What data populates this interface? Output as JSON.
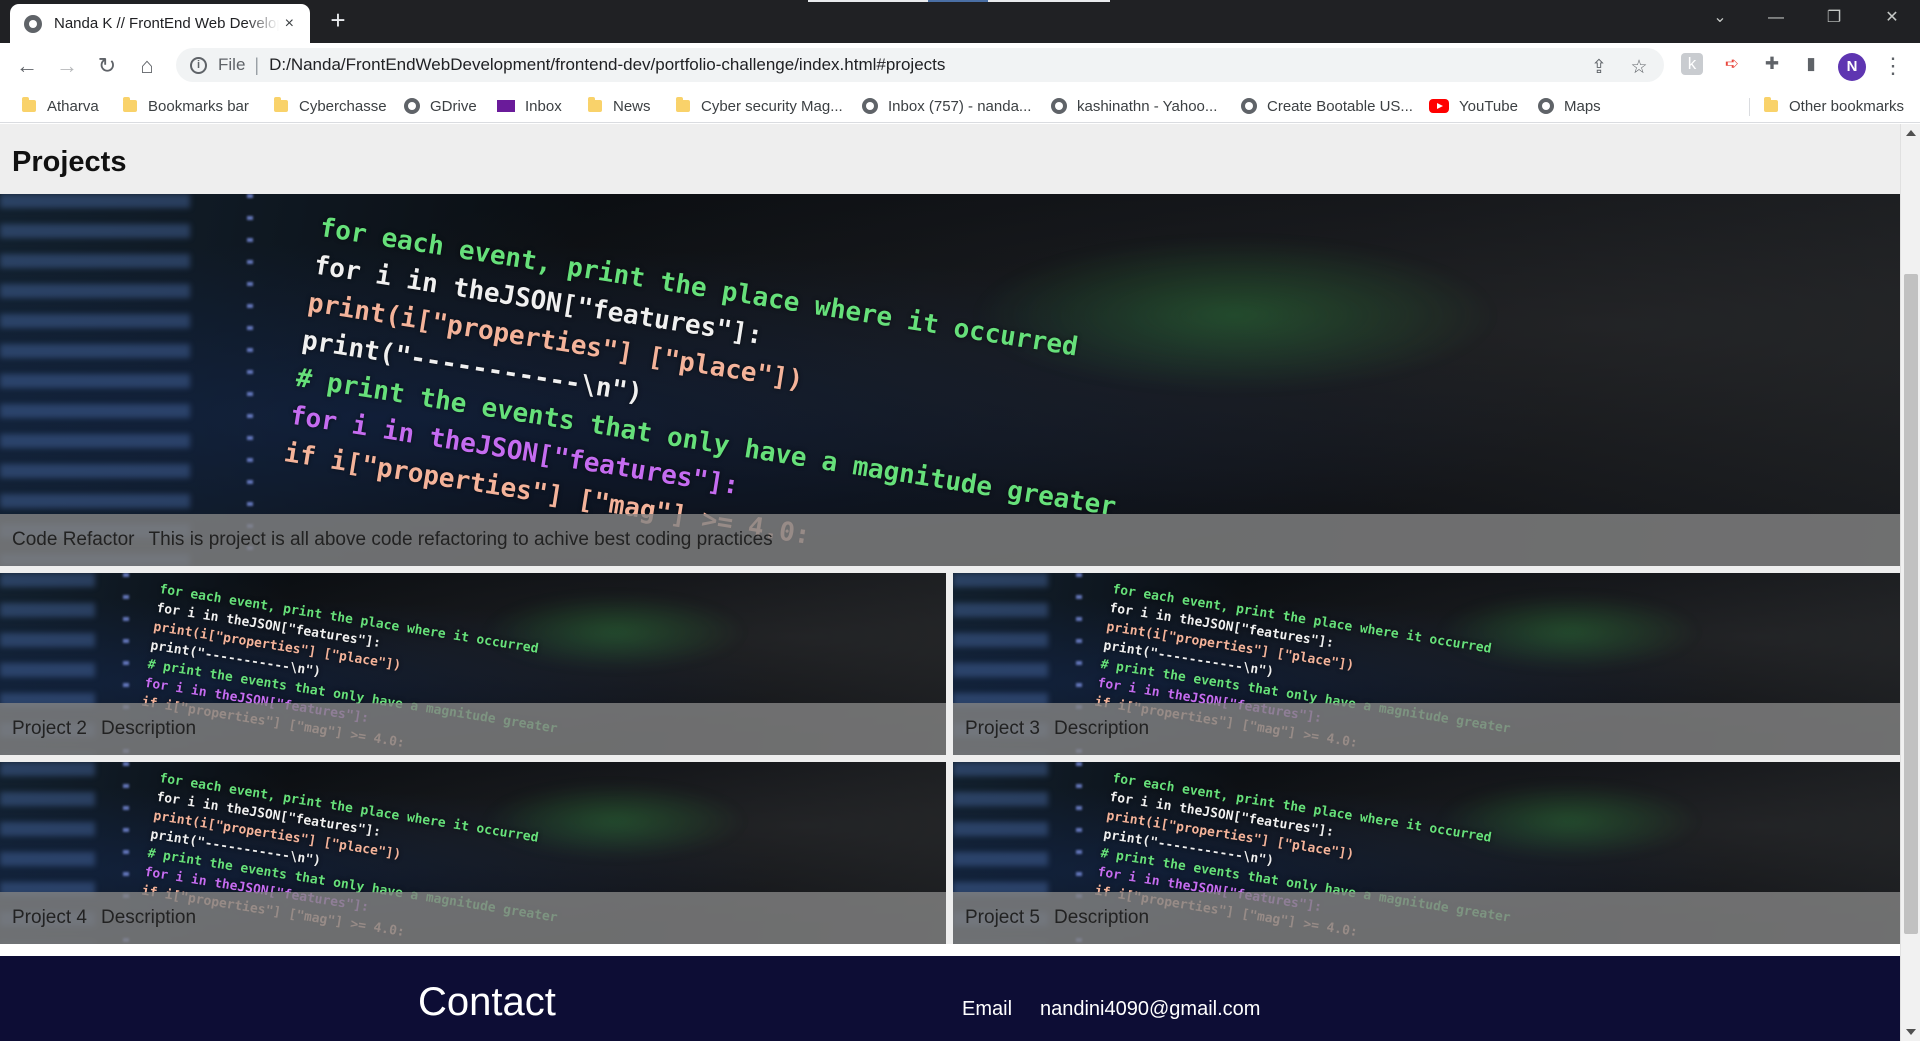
{
  "browser": {
    "tab_title": "Nanda K // FrontEnd Web Developer",
    "tab_close": "×",
    "new_tab": "+",
    "url_scheme": "File",
    "url_separator": "|",
    "url": "D:/Nanda/FrontEndWebDevelopment/frontend-dev/portfolio-challenge/index.html#projects",
    "profile_initial": "N",
    "window_controls": [
      "⌄",
      "—",
      "❐",
      "✕"
    ]
  },
  "bookmarks": [
    {
      "label": "Atharva",
      "icon": "folder-icon"
    },
    {
      "label": "Bookmarks bar",
      "icon": "folder-icon"
    },
    {
      "label": "Cyberchasse",
      "icon": "folder-icon"
    },
    {
      "label": "GDrive",
      "icon": "globe-icon"
    },
    {
      "label": "Inbox",
      "icon": "mail-icon"
    },
    {
      "label": "News",
      "icon": "folder-icon"
    },
    {
      "label": "Cyber security Mag...",
      "icon": "folder-icon"
    },
    {
      "label": "Inbox (757) - nanda...",
      "icon": "globe-icon"
    },
    {
      "label": "kashinathn - Yahoo...",
      "icon": "globe-icon"
    },
    {
      "label": "Create Bootable US...",
      "icon": "globe-icon"
    },
    {
      "label": "YouTube",
      "icon": "youtube-icon"
    },
    {
      "label": "Maps",
      "icon": "globe-icon"
    },
    {
      "label": "Other bookmarks",
      "icon": "folder-icon"
    }
  ],
  "page": {
    "section_title": "Projects",
    "projects": [
      {
        "title": "Code Refactor",
        "description": "This is project is all above code refactoring to achive best coding practices"
      },
      {
        "title": "Project 2",
        "description": "Description"
      },
      {
        "title": "Project 3",
        "description": "Description"
      },
      {
        "title": "Project 4",
        "description": "Description"
      },
      {
        "title": "Project 5",
        "description": "Description"
      }
    ],
    "code_image_lines": [
      "for each event, print the place where it occurred",
      "for i in theJSON[\"features\"]:",
      "print(i[\"properties\"] [\"place\"])",
      "print(\"-----------\\n\")",
      "# print the events that only have a magnitude greater",
      "for i in theJSON[\"features\"]:",
      "if i[\"properties\"] [\"mag\"] >= 4.0:"
    ],
    "contact": {
      "heading": "Contact",
      "email_label": "Email",
      "email_value": "nandini4090@gmail.com"
    }
  },
  "colors": {
    "footer_bg": "#0d0d35",
    "page_bg": "#eeeeee",
    "caption_overlay": "rgba(130,130,130,0.82)",
    "avatar": "#5e35b1"
  }
}
